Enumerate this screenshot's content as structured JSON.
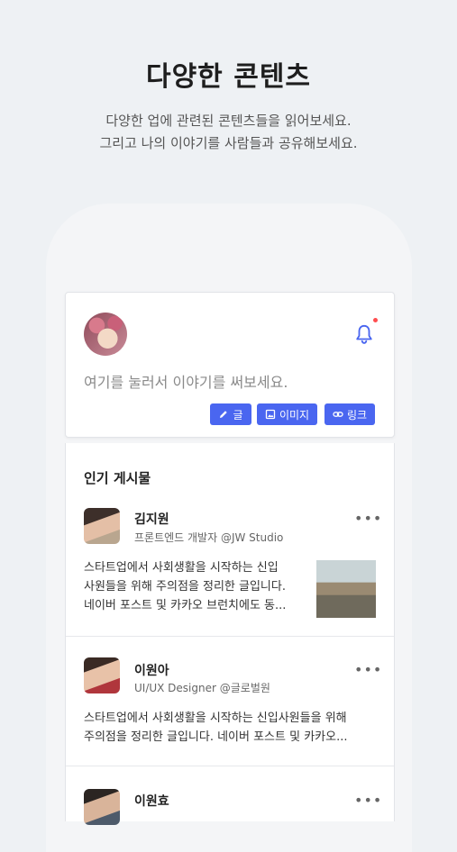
{
  "hero": {
    "title": "다양한 콘텐츠",
    "subtitle_line1": "다양한 업에 관련된 콘텐츠들을 읽어보세요.",
    "subtitle_line2": "그리고 나의 이야기를 사람들과 공유해보세요."
  },
  "composer": {
    "placeholder": "여기를 눌러서 이야기를 써보세요.",
    "buttons": [
      {
        "label": "글",
        "icon": "pencil-icon"
      },
      {
        "label": "이미지",
        "icon": "image-icon"
      },
      {
        "label": "링크",
        "icon": "link-icon"
      }
    ],
    "notification_icon": "bell-icon",
    "accent_color": "#4a66f0"
  },
  "feed": {
    "section_title": "인기 게시물",
    "posts": [
      {
        "author": "김지원",
        "meta": "프론트엔드 개발자 @JW Studio",
        "text_line1": "스타트업에서 사회생활을 시작하는 신입",
        "text_line2": "사원들을 위해 주의점을 정리한 글입니다.",
        "text_line3": "네이버 포스트 및 카카오 브런치에도 동..."
      },
      {
        "author": "이원아",
        "meta": "UI/UX Designer @글로벌원",
        "text_line1": "스타트업에서 사회생활을 시작하는 신입사원들을 위해",
        "text_line2": "주의점을 정리한 글입니다. 네이버 포스트 및 카카오..."
      },
      {
        "author": "이원효",
        "meta": ""
      }
    ],
    "more_label": "•••"
  }
}
